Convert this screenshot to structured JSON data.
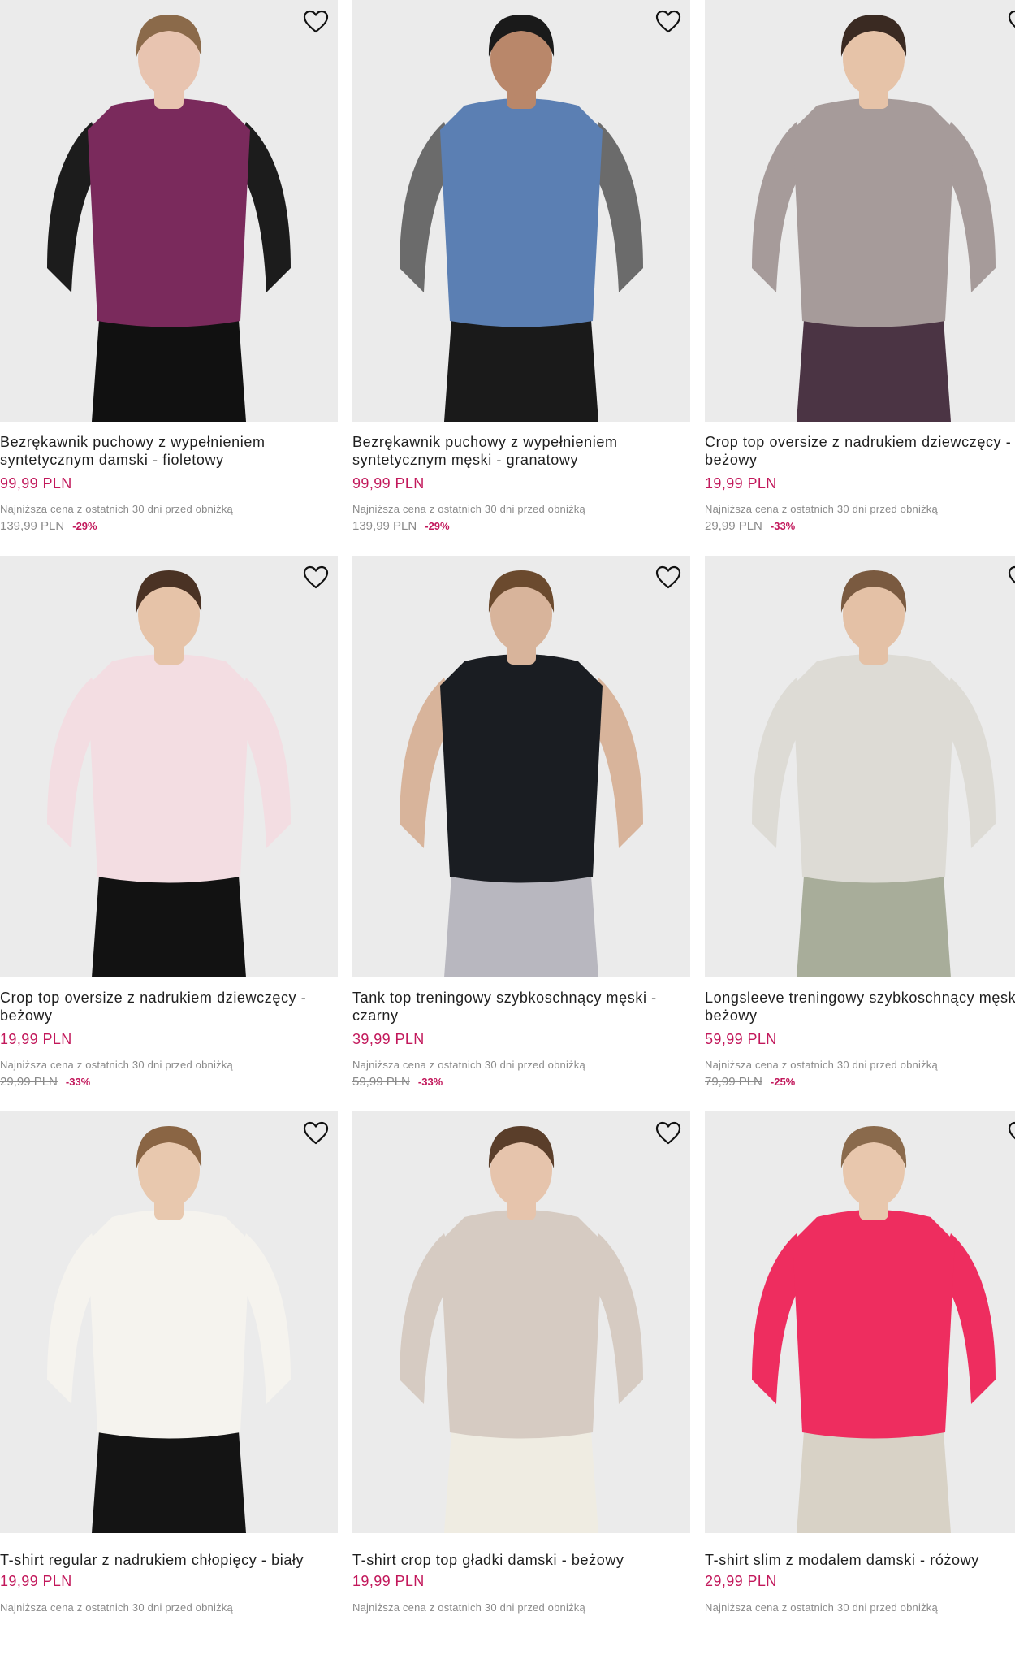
{
  "products": [
    {
      "name": "Bezrękawnik puchowy z wypełnieniem syntetycznym damski - fioletowy",
      "price": "99,99 PLN",
      "lowest_note": "Najniższa cena z ostatnich 30 dni przed obniżką",
      "old_price": "139,99 PLN",
      "discount": "-29%",
      "colors": {
        "bg": "#ebebeb",
        "garment": "#7a2a5c",
        "sleeve": "#1c1c1c",
        "bottom": "#111111",
        "skin": "#e8c4b0",
        "hair": "#8b6a4a"
      }
    },
    {
      "name": "Bezrękawnik puchowy z wypełnieniem syntetycznym męski - granatowy",
      "price": "99,99 PLN",
      "lowest_note": "Najniższa cena z ostatnich 30 dni przed obniżką",
      "old_price": "139,99 PLN",
      "discount": "-29%",
      "colors": {
        "bg": "#ebebeb",
        "garment": "#5b7fb3",
        "sleeve": "#6b6b6b",
        "bottom": "#1a1a1a",
        "skin": "#b9876a",
        "hair": "#1a1a1a"
      }
    },
    {
      "name": "Crop top oversize z nadrukiem dziewczęcy - beżowy",
      "price": "19,99 PLN",
      "lowest_note": "Najniższa cena z ostatnich 30 dni przed obniżką",
      "old_price": "29,99 PLN",
      "discount": "-33%",
      "colors": {
        "bg": "#ebebeb",
        "garment": "#a69b9a",
        "sleeve": "#a69b9a",
        "bottom": "#4b3444",
        "skin": "#e6c3a8",
        "hair": "#3a2a22"
      }
    },
    {
      "name": "Crop top oversize z nadrukiem dziewczęcy - beżowy",
      "price": "19,99 PLN",
      "lowest_note": "Najniższa cena z ostatnich 30 dni przed obniżką",
      "old_price": "29,99 PLN",
      "discount": "-33%",
      "colors": {
        "bg": "#ebebeb",
        "garment": "#f3dde2",
        "sleeve": "#f3dde2",
        "bottom": "#121212",
        "skin": "#e6c3a8",
        "hair": "#4a3224"
      }
    },
    {
      "name": "Tank top treningowy szybkoschnący męski - czarny",
      "price": "39,99 PLN",
      "lowest_note": "Najniższa cena z ostatnich 30 dni przed obniżką",
      "old_price": "59,99 PLN",
      "discount": "-33%",
      "colors": {
        "bg": "#ebebeb",
        "garment": "#1a1d22",
        "sleeve": "#d8b49b",
        "bottom": "#b8b7bf",
        "skin": "#d8b49b",
        "hair": "#6b4a2e"
      }
    },
    {
      "name": "Longsleeve treningowy szybkoschnący męski - beżowy",
      "price": "59,99 PLN",
      "lowest_note": "Najniższa cena z ostatnich 30 dni przed obniżką",
      "old_price": "79,99 PLN",
      "discount": "-25%",
      "colors": {
        "bg": "#ebebeb",
        "garment": "#dddbd5",
        "sleeve": "#dddbd5",
        "bottom": "#a8ad9a",
        "skin": "#e4c1a6",
        "hair": "#7a5a40"
      }
    },
    {
      "name": "T-shirt regular z nadrukiem chłopięcy - biały",
      "price": "19,99 PLN",
      "lowest_note": "Najniższa cena z ostatnich 30 dni przed obniżką",
      "old_price": "",
      "discount": "",
      "colors": {
        "bg": "#ebebeb",
        "garment": "#f5f3ee",
        "sleeve": "#f5f3ee",
        "bottom": "#141414",
        "skin": "#e8c8ae",
        "hair": "#8a6544"
      }
    },
    {
      "name": "T-shirt crop top gładki damski - beżowy",
      "price": "19,99 PLN",
      "lowest_note": "Najniższa cena z ostatnich 30 dni przed obniżką",
      "old_price": "",
      "discount": "",
      "colors": {
        "bg": "#ebebeb",
        "garment": "#d6cbc2",
        "sleeve": "#d6cbc2",
        "bottom": "#efece2",
        "skin": "#e6c4ac",
        "hair": "#5a3e2a"
      }
    },
    {
      "name": "T-shirt slim z modalem damski - różowy",
      "price": "29,99 PLN",
      "lowest_note": "Najniższa cena z ostatnich 30 dni przed obniżką",
      "old_price": "",
      "discount": "",
      "colors": {
        "bg": "#ebebeb",
        "garment": "#ee2d5f",
        "sleeve": "#ee2d5f",
        "bottom": "#d8d2c6",
        "skin": "#e8c7ad",
        "hair": "#8a6a4c"
      }
    }
  ],
  "icons": {
    "wishlist": "heart-outline-icon"
  }
}
